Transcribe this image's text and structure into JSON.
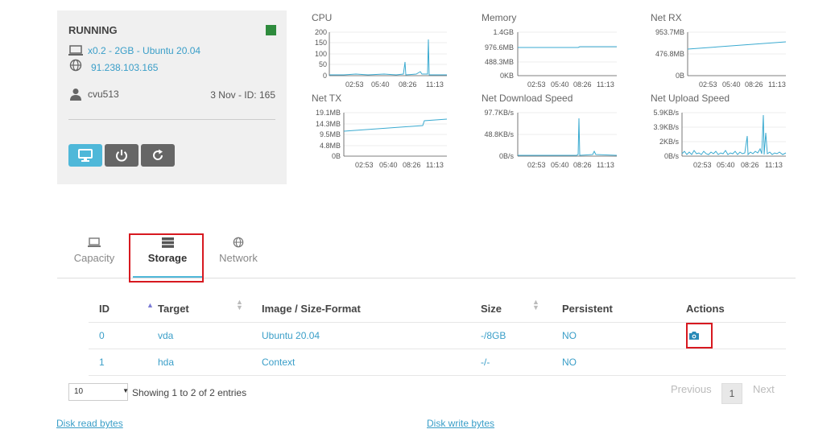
{
  "vm": {
    "status": "RUNNING",
    "status_color": "#2e8b3d",
    "template": "x0.2 - 2GB - Ubuntu 20.04",
    "ip": "91.238.103.165",
    "user": "cvu513",
    "created_id": "3 Nov - ID: 165"
  },
  "buttons": [
    {
      "icon": "monitor-icon"
    },
    {
      "icon": "power-icon"
    },
    {
      "icon": "refresh-icon"
    }
  ],
  "charts": {
    "cpu": {
      "title": "CPU",
      "yticks": [
        "200",
        "150",
        "100",
        "50",
        "0"
      ],
      "xticks": [
        "02:53",
        "05:40",
        "08:26",
        "11:13"
      ]
    },
    "memory": {
      "title": "Memory",
      "yticks": [
        "1.4GB",
        "976.6MB",
        "488.3MB",
        "0KB"
      ],
      "xticks": [
        "02:53",
        "05:40",
        "08:26",
        "11:13"
      ]
    },
    "netrx": {
      "title": "Net RX",
      "yticks": [
        "953.7MB",
        "476.8MB",
        "0B"
      ],
      "xticks": [
        "02:53",
        "05:40",
        "08:26",
        "11:13"
      ]
    },
    "nettx": {
      "title": "Net TX",
      "yticks": [
        "19.1MB",
        "14.3MB",
        "9.5MB",
        "4.8MB",
        "0B"
      ],
      "xticks": [
        "02:53",
        "05:40",
        "08:26",
        "11:13"
      ]
    },
    "netdl": {
      "title": "Net Download Speed",
      "yticks": [
        "97.7KB/s",
        "48.8KB/s",
        "0B/s"
      ],
      "xticks": [
        "02:53",
        "05:40",
        "08:26",
        "11:13"
      ]
    },
    "netul": {
      "title": "Net Upload Speed",
      "yticks": [
        "5.9KB/s",
        "3.9KB/s",
        "2KB/s",
        "0B/s"
      ],
      "xticks": [
        "02:53",
        "05:40",
        "08:26",
        "11:13"
      ]
    }
  },
  "tabs": [
    {
      "label": "Capacity",
      "icon": "laptop-icon"
    },
    {
      "label": "Storage",
      "icon": "server-icon"
    },
    {
      "label": "Network",
      "icon": "globe-icon"
    }
  ],
  "table": {
    "headers": {
      "id": "ID",
      "target": "Target",
      "image": "Image / Size-Format",
      "size": "Size",
      "persistent": "Persistent",
      "actions": "Actions"
    },
    "rows": [
      {
        "id": "0",
        "target": "vda",
        "image": "Ubuntu 20.04",
        "size": "-/8GB",
        "persistent": "NO",
        "action_icon": "camera-icon"
      },
      {
        "id": "1",
        "target": "hda",
        "image": "Context",
        "size": "-/-",
        "persistent": "NO",
        "action_icon": ""
      }
    ]
  },
  "length_select": "10",
  "entries_info": "Showing 1 to 2 of 2 entries",
  "pagination": {
    "previous": "Previous",
    "page": "1",
    "next": "Next"
  },
  "bottom_links": {
    "disk_read": "Disk read bytes",
    "disk_write": "Disk write bytes"
  },
  "colors": {
    "accent": "#4fb8d9",
    "link": "#3a9ec8",
    "highlight": "#d71920"
  }
}
